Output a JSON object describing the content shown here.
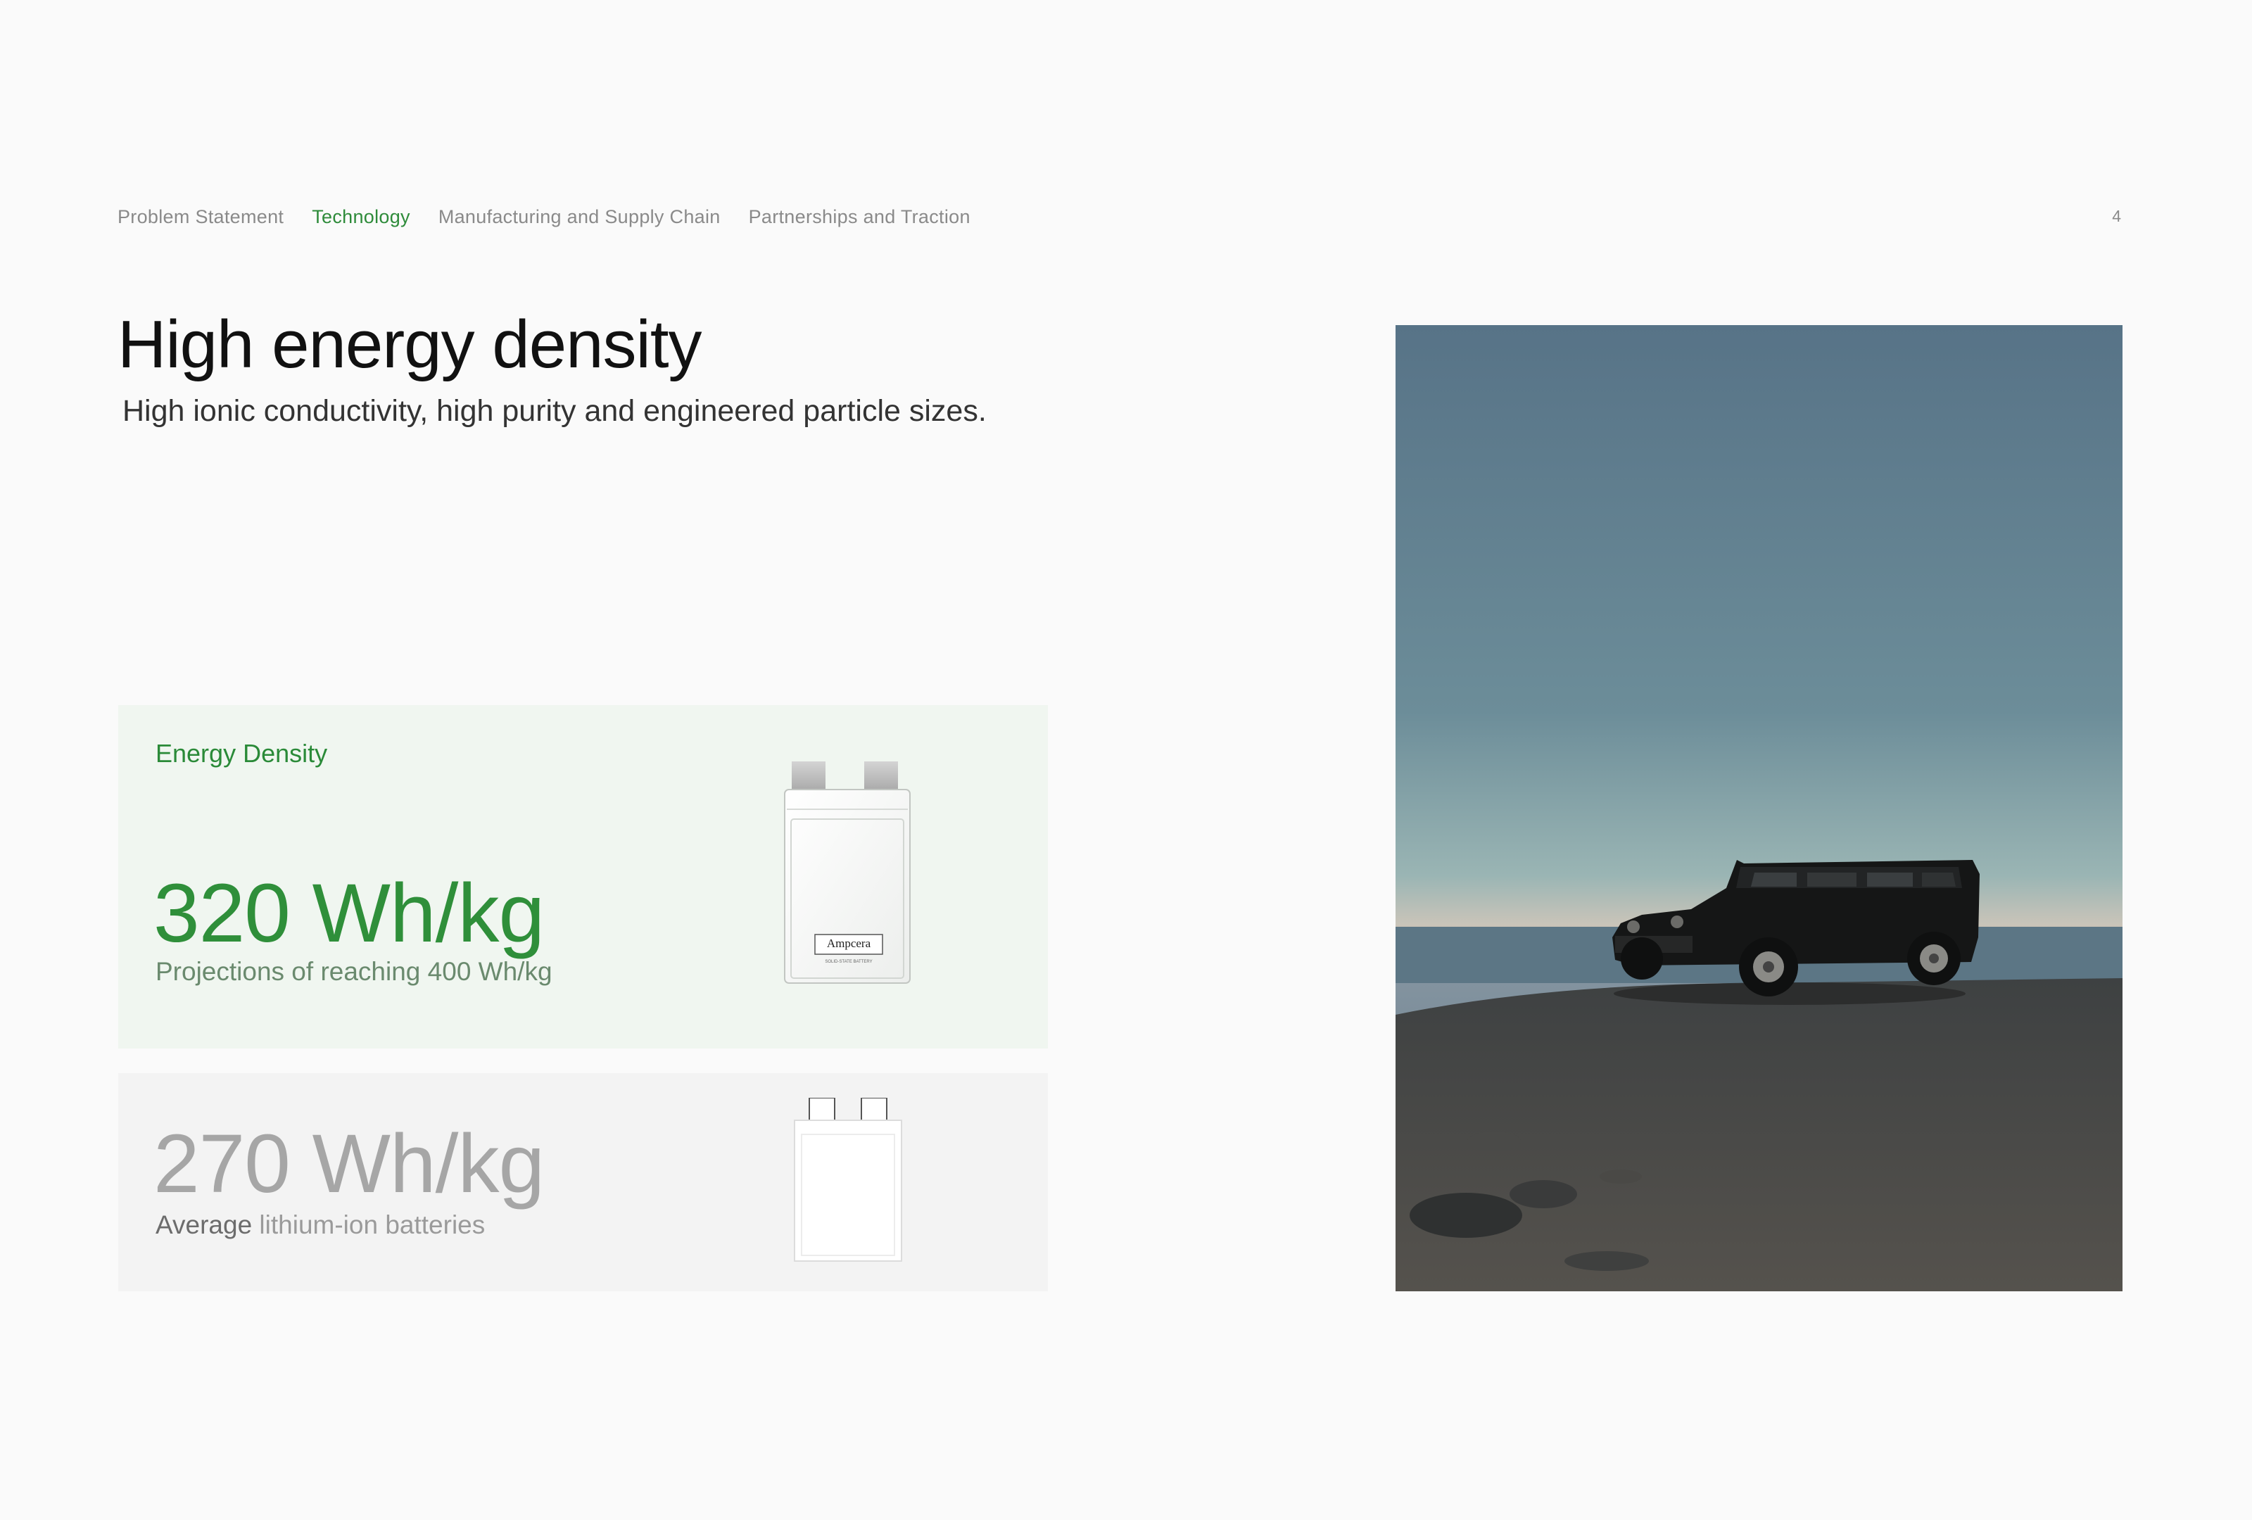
{
  "nav": {
    "items": [
      {
        "label": "Problem Statement",
        "active": false
      },
      {
        "label": "Technology",
        "active": true
      },
      {
        "label": "Manufacturing and Supply Chain",
        "active": false
      },
      {
        "label": "Partnerships and Traction",
        "active": false
      }
    ],
    "page_number": "4"
  },
  "header": {
    "title": "High energy density",
    "subtitle": "High ionic conductivity, high purity and engineered particle sizes."
  },
  "energy_card": {
    "label": "Energy Density",
    "value": "320 Wh/kg",
    "caption": "Projections of reaching 400 Wh/kg",
    "cell_brand": "Ampcera",
    "cell_subtext": "SOLID-STATE BATTERY"
  },
  "comparison_card": {
    "value": "270 Wh/kg",
    "caption_strong": "Average",
    "caption_rest": " lithium-ion batteries"
  },
  "photo": {
    "subject": "black off-road vehicle parked on a cliff edge at dusk"
  },
  "colors": {
    "accent_green": "#2e8b3a",
    "primary_card_bg": "#f0f6f0",
    "secondary_card_bg": "#f3f3f3",
    "nav_gray": "#8a8a8a"
  }
}
